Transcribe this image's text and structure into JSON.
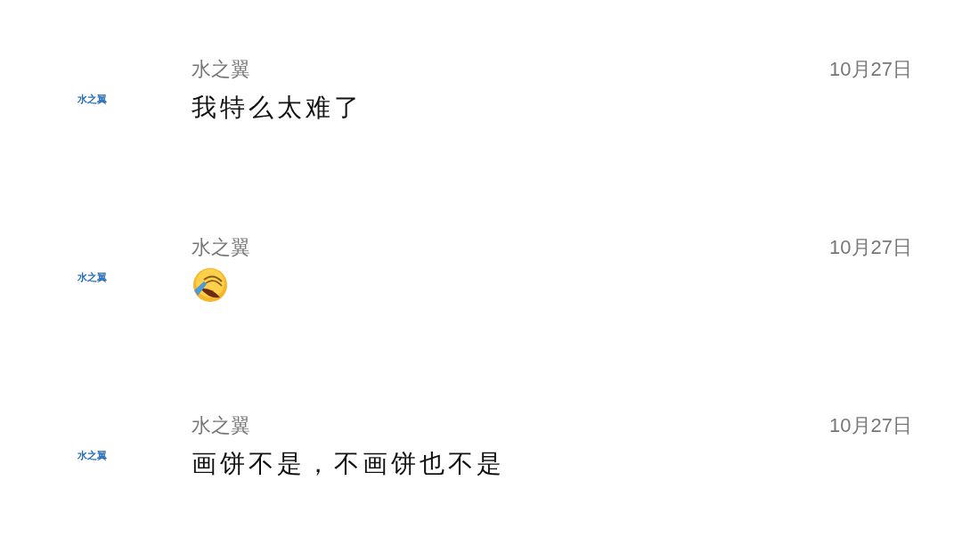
{
  "comments": [
    {
      "avatar_text": "水之翼",
      "author": "水之翼",
      "date": "10月27日",
      "kind": "text",
      "text": "我特么太难了"
    },
    {
      "avatar_text": "水之翼",
      "author": "水之翼",
      "date": "10月27日",
      "kind": "emoji"
    },
    {
      "avatar_text": "水之翼",
      "author": "水之翼",
      "date": "10月27日",
      "kind": "text",
      "text": "画饼不是，不画饼也不是"
    }
  ]
}
